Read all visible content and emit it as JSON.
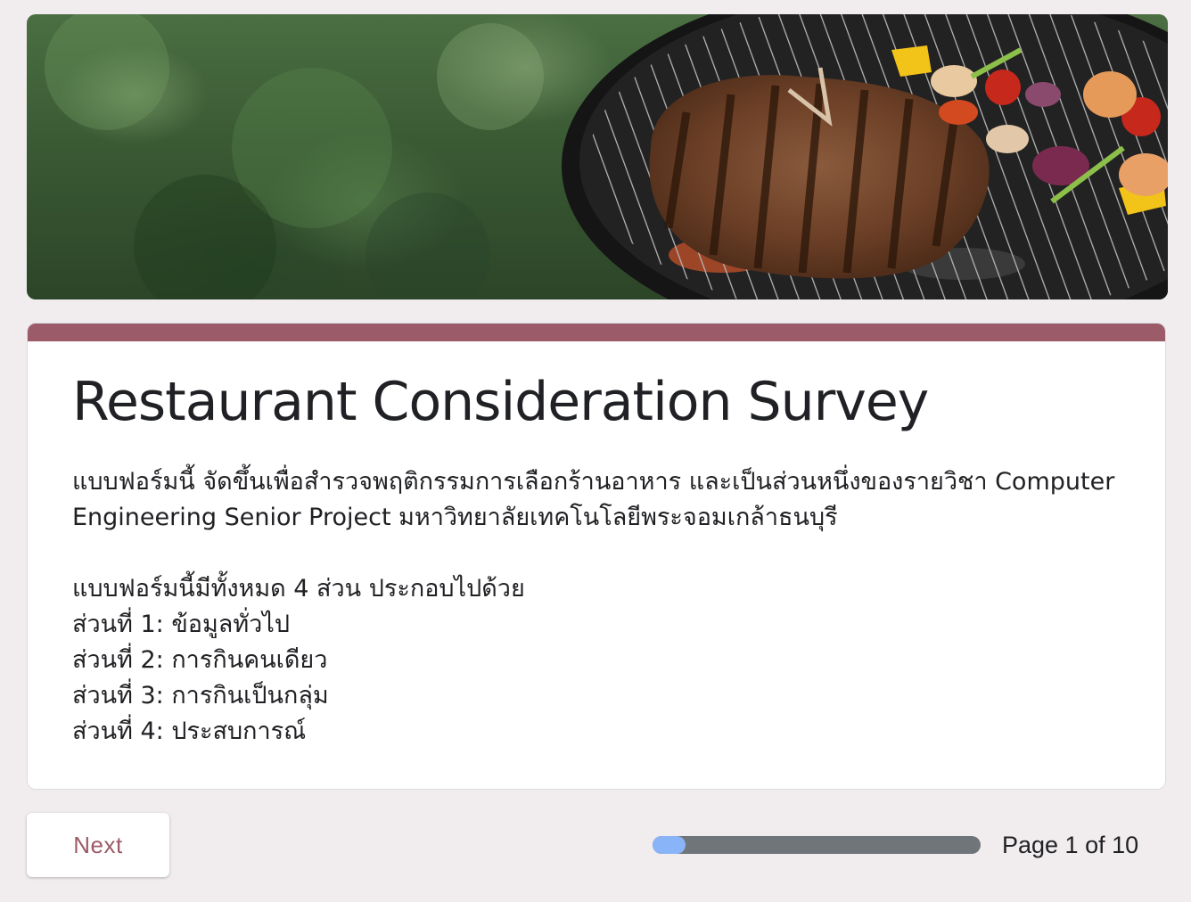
{
  "form": {
    "title": "Restaurant Consideration Survey",
    "description_lines": [
      "แบบฟอร์มนี้ จัดขึ้นเพื่อสำรวจพฤติกรรมการเลือกร้านอาหาร และเป็นส่วนหนึ่งของรายวิชา Computer",
      "Engineering Senior Project มหาวิทยาลัยเทคโนโลยีพระจอมเกล้าธนบุรี"
    ],
    "sections_intro": "แบบฟอร์มนี้มีทั้งหมด 4 ส่วน ประกอบไปด้วย",
    "sections": [
      "ส่วนที่ 1: ข้อมูลทั่วไป",
      "ส่วนที่ 2: การกินคนเดียว",
      "ส่วนที่ 3: การกินเป็นกลุ่ม",
      "ส่วนที่ 4: ประสบการณ์"
    ]
  },
  "navigation": {
    "next_label": "Next",
    "page_label": "Page 1 of 10",
    "progress_fraction": 0.1
  },
  "colors": {
    "accent": "#9c5b68",
    "progress_fill": "#8ab4f8",
    "progress_track": "#70757a",
    "background": "#f1edee"
  }
}
